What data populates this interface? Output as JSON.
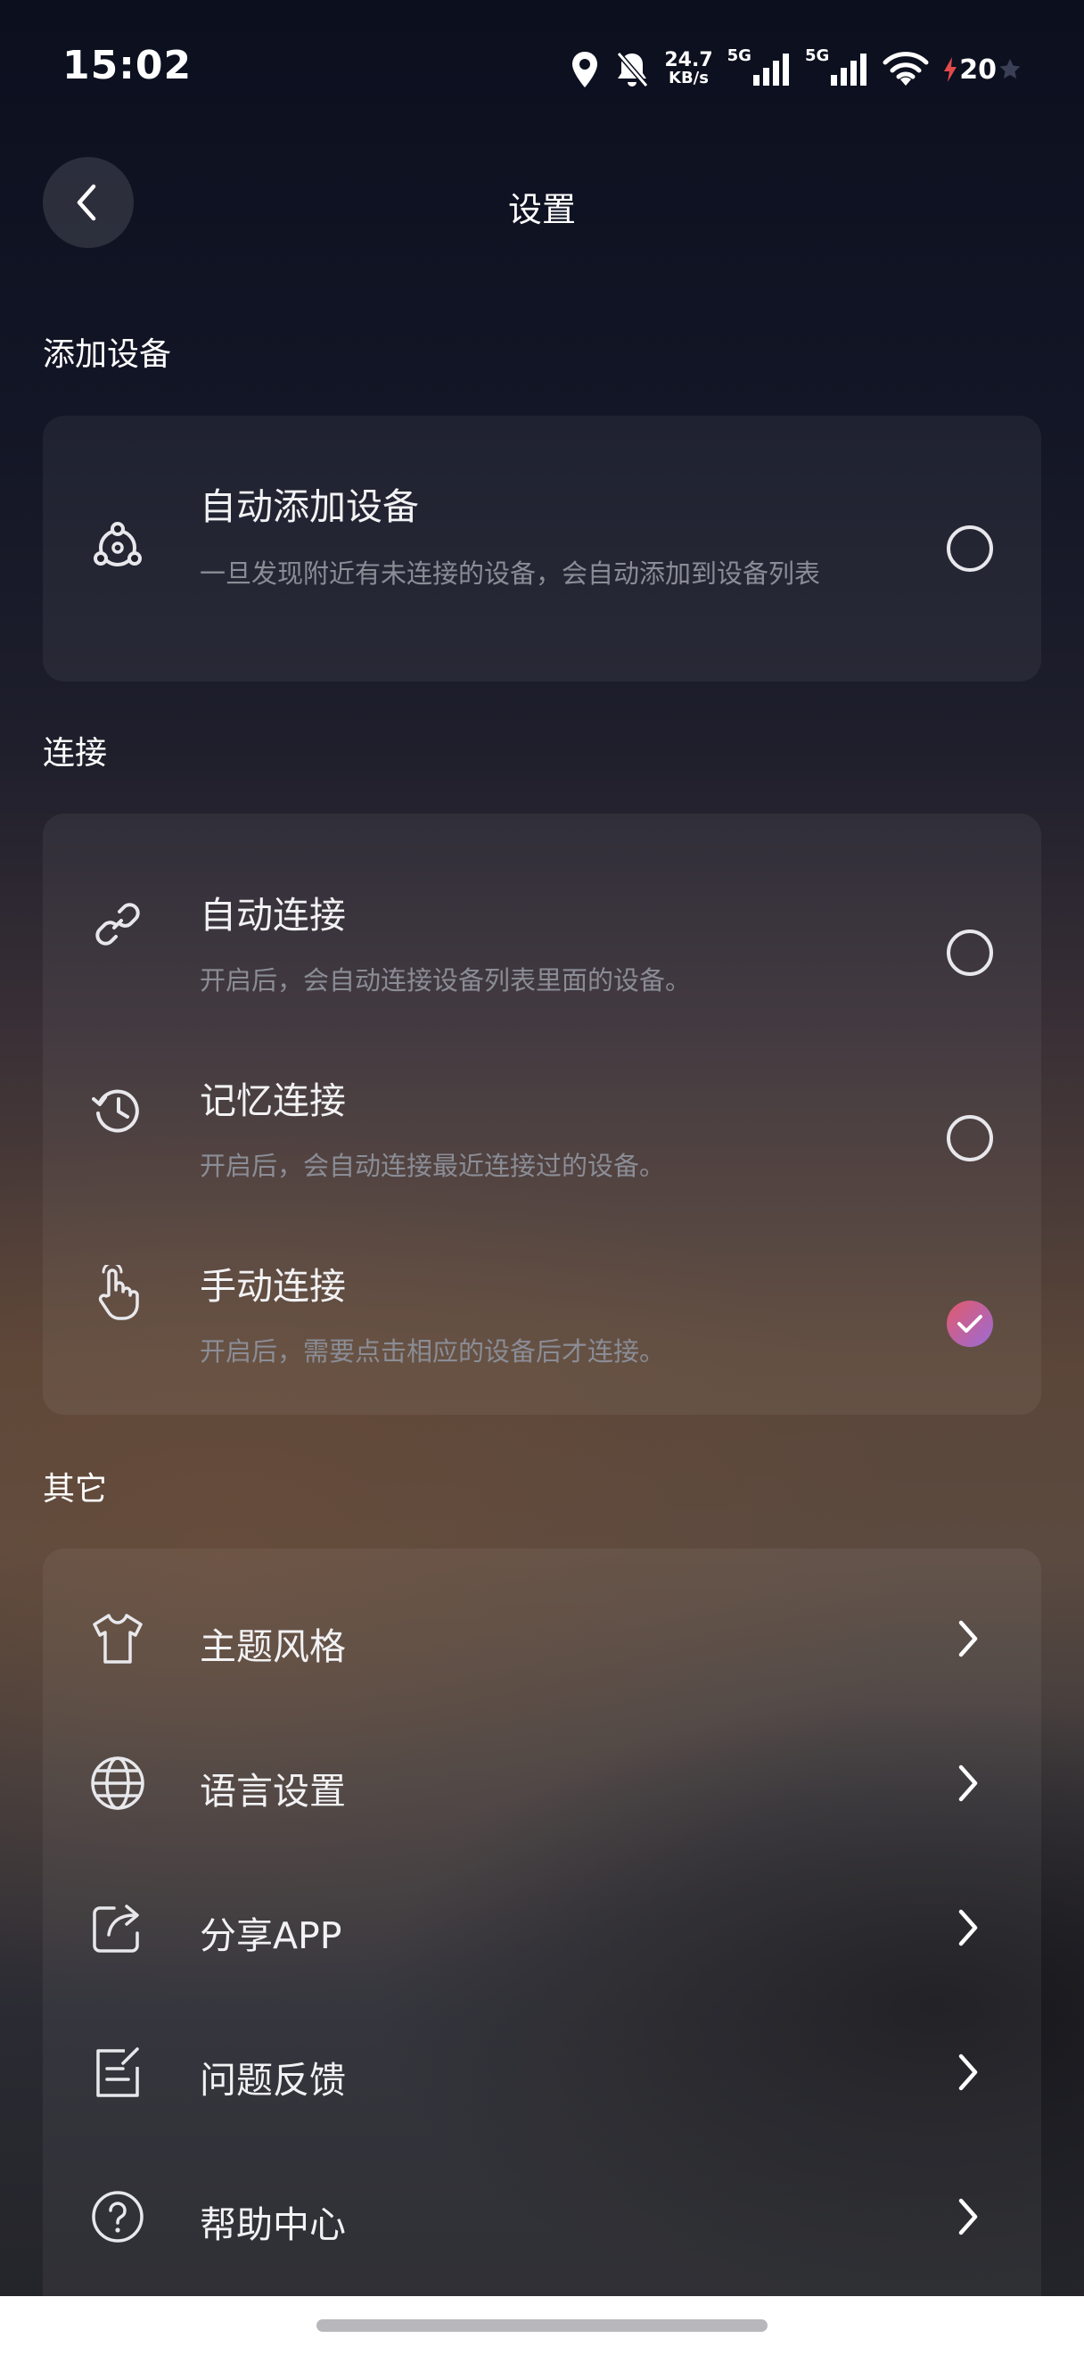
{
  "status": {
    "time": "15:02",
    "net_speed_value": "24.7",
    "net_speed_unit": "KB/s",
    "sim1_label": "5G",
    "sim2_label": "5G",
    "battery": "20"
  },
  "header": {
    "title": "设置"
  },
  "sections": {
    "add_device": {
      "label": "添加设备",
      "items": [
        {
          "title": "自动添加设备",
          "subtitle": "一旦发现附近有未连接的设备，会自动添加到设备列表",
          "icon": "auto-add-device-icon",
          "checked": false
        }
      ]
    },
    "connect": {
      "label": "连接",
      "items": [
        {
          "title": "自动连接",
          "subtitle": "开启后，会自动连接设备列表里面的设备。",
          "icon": "link-icon",
          "checked": false
        },
        {
          "title": "记忆连接",
          "subtitle": "开启后，会自动连接最近连接过的设备。",
          "icon": "history-icon",
          "checked": false
        },
        {
          "title": "手动连接",
          "subtitle": "开启后，需要点击相应的设备后才连接。",
          "icon": "hand-tap-icon",
          "checked": true
        }
      ]
    },
    "other": {
      "label": "其它",
      "items": [
        {
          "title": "主题风格",
          "icon": "tshirt-icon"
        },
        {
          "title": "语言设置",
          "icon": "globe-icon"
        },
        {
          "title": "分享APP",
          "icon": "share-icon"
        },
        {
          "title": "问题反馈",
          "icon": "feedback-icon"
        },
        {
          "title": "帮助中心",
          "icon": "help-icon"
        }
      ]
    }
  },
  "colors": {
    "accent_gradient_start": "#e35a6a",
    "accent_gradient_end": "#9a6bd8",
    "subtitle": "#8b8d96"
  }
}
